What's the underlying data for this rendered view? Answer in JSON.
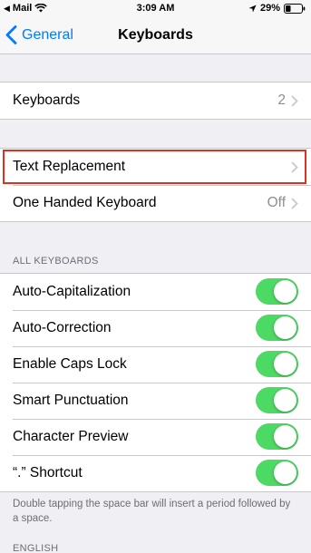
{
  "status": {
    "carrier": "Mail",
    "time": "3:09 AM",
    "battery": "29%"
  },
  "nav": {
    "back_label": "General",
    "title": "Keyboards"
  },
  "keyboards_row": {
    "label": "Keyboards",
    "value": "2"
  },
  "text_replacement": {
    "label": "Text Replacement"
  },
  "one_handed": {
    "label": "One Handed Keyboard",
    "value": "Off"
  },
  "all_keyboards": {
    "header": "ALL KEYBOARDS",
    "items": [
      {
        "label": "Auto-Capitalization",
        "on": true
      },
      {
        "label": "Auto-Correction",
        "on": true
      },
      {
        "label": "Enable Caps Lock",
        "on": true
      },
      {
        "label": "Smart Punctuation",
        "on": true
      },
      {
        "label": "Character Preview",
        "on": true
      },
      {
        "label": "“.” Shortcut",
        "on": true
      }
    ],
    "footer": "Double tapping the space bar will insert a period followed by a space."
  },
  "english": {
    "header": "ENGLISH"
  },
  "colors": {
    "accent": "#007aff",
    "toggle_on": "#4cd964",
    "highlight": "#e0301e",
    "background": "#efeff4"
  }
}
